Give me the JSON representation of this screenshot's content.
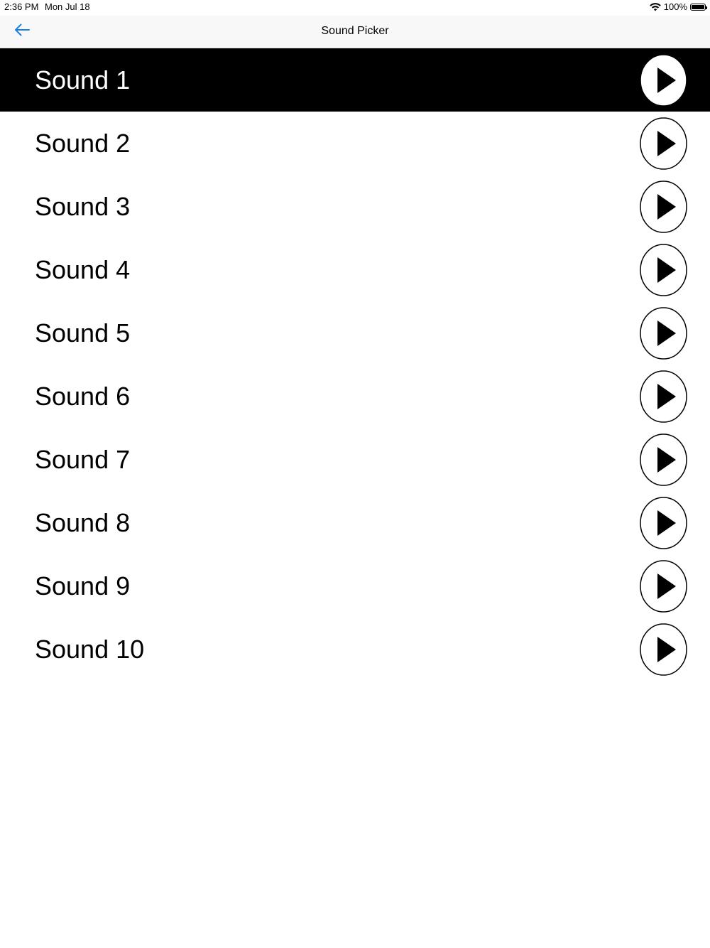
{
  "status_bar": {
    "time": "2:36 PM",
    "date": "Mon Jul 18",
    "battery_percent": "100%",
    "battery_level": 1.0
  },
  "nav": {
    "title": "Sound Picker",
    "back_icon": "arrow-left-icon",
    "accent_color": "#1a7fe6"
  },
  "sounds": [
    {
      "label": "Sound 1",
      "selected": true
    },
    {
      "label": "Sound 2",
      "selected": false
    },
    {
      "label": "Sound 3",
      "selected": false
    },
    {
      "label": "Sound 4",
      "selected": false
    },
    {
      "label": "Sound 5",
      "selected": false
    },
    {
      "label": "Sound 6",
      "selected": false
    },
    {
      "label": "Sound 7",
      "selected": false
    },
    {
      "label": "Sound 8",
      "selected": false
    },
    {
      "label": "Sound 9",
      "selected": false
    },
    {
      "label": "Sound 10",
      "selected": false
    }
  ],
  "row_icon": "play-icon",
  "colors": {
    "selected_background": "#000000",
    "selected_text": "#ffffff",
    "text": "#000000",
    "background": "#ffffff"
  }
}
